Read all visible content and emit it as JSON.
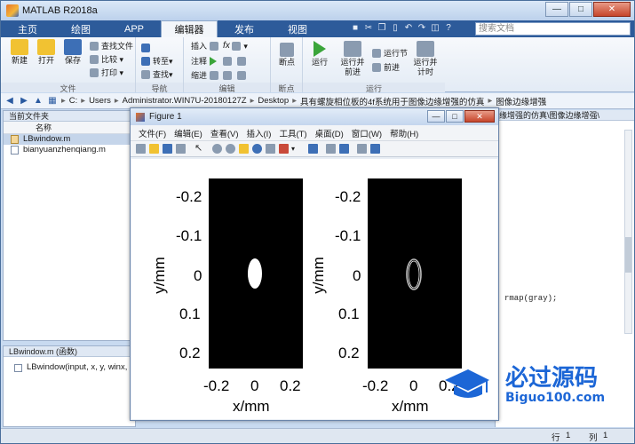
{
  "window": {
    "title": "MATLAB R2018a"
  },
  "tabs": [
    "主页",
    "绘图",
    "APP",
    "编辑器",
    "发布",
    "视图"
  ],
  "search": {
    "placeholder": "搜索文档"
  },
  "ribbon": {
    "file": {
      "new": "新建",
      "open": "打开",
      "save": "保存",
      "find_files": "查找文件",
      "compare": "比较",
      "print": "打印",
      "group": "文件"
    },
    "nav": {
      "goto": "转至",
      "find": "查找",
      "group": "导航"
    },
    "edit": {
      "insert": "插入",
      "comment": "注释",
      "indent": "缩进",
      "group": "编辑"
    },
    "breakpoints": {
      "label": "断点",
      "group": "断点"
    },
    "run": {
      "run": "运行",
      "run_advance_1": "运行并",
      "run_advance_2": "前进",
      "run_section": "运行节",
      "advance": "前进",
      "run_time_1": "运行并",
      "run_time_2": "计时",
      "group": "运行"
    }
  },
  "path": [
    "C:",
    "Users",
    "Administrator.WIN7U-20180127Z",
    "Desktop",
    "具有螺旋相位板的4f系统用于图像边缘增强的仿真",
    "图像边缘增强"
  ],
  "current_folder": {
    "header": "当前文件夹",
    "col_name": "名称",
    "files": [
      "LBwindow.m",
      "bianyuanzhenqiang.m"
    ]
  },
  "details": {
    "header": "LBwindow.m  (函数)",
    "signature": "LBwindow(input, x, y, winx, ..."
  },
  "editor": {
    "tab": "缘增强的仿真\\图像边缘增强\\",
    "code_fragment": "rmap(gray);"
  },
  "status": {
    "row_label": "行",
    "row": "1",
    "col_label": "列",
    "col": "1"
  },
  "figure": {
    "title": "Figure 1",
    "menu": [
      "文件(F)",
      "编辑(E)",
      "查看(V)",
      "插入(I)",
      "工具(T)",
      "桌面(D)",
      "窗口(W)",
      "帮助(H)"
    ],
    "plots": [
      {
        "xlabel": "x/mm",
        "ylabel": "y/mm",
        "xticks": [
          "-0.2",
          "0",
          "0.2"
        ],
        "yticks": [
          "-0.2",
          "-0.1",
          "0",
          "0.1",
          "0.2"
        ],
        "content": "filled-ellipse"
      },
      {
        "xlabel": "x/mm",
        "ylabel": "y/mm",
        "xticks": [
          "-0.2",
          "0",
          "0.2"
        ],
        "yticks": [
          "-0.2",
          "-0.1",
          "0",
          "0.1",
          "0.2"
        ],
        "content": "ellipse-edge"
      }
    ]
  },
  "watermark": {
    "cn": "必过源码",
    "en": "Biguo100.com"
  },
  "colors": {
    "tab_bar": "#2d5b9a",
    "accent": "#1c66d6",
    "plot_bg": "#000000"
  }
}
